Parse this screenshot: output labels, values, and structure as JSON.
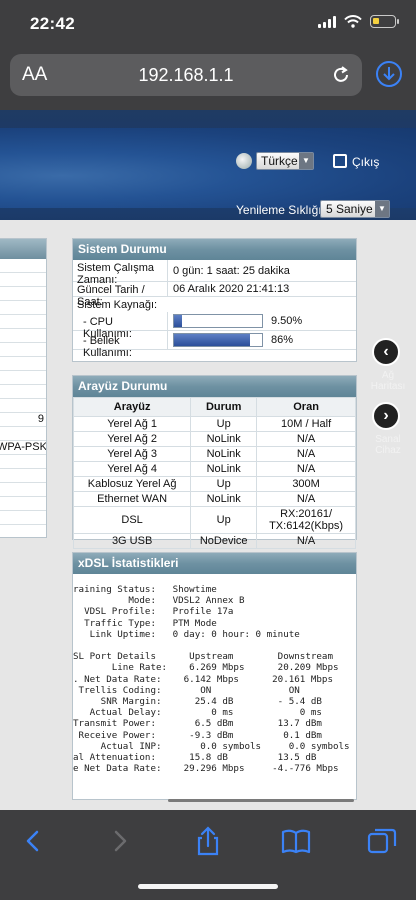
{
  "status_bar": {
    "time": "22:42"
  },
  "browser": {
    "text_size_label": "AA",
    "url": "192.168.1.1"
  },
  "header": {
    "language": "Türkçe",
    "logout": "Çıkış",
    "refresh_label": "Yenileme Sıklığı:",
    "refresh_value": "5 Saniye"
  },
  "left_panel": {
    "rows": [
      "",
      "",
      "",
      "",
      "",
      "",
      "",
      "",
      "",
      "",
      "",
      "9",
      "",
      "WPA-PSK",
      "",
      "",
      "",
      "",
      ""
    ]
  },
  "system_status": {
    "title": "Sistem Durumu",
    "uptime_label": "Sistem Çalışma Zamanı:",
    "uptime_value": "0 gün: 1 saat: 25 dakika",
    "datetime_label": "Güncel Tarih / Saat:",
    "datetime_value": "06 Aralık 2020 21:41:13",
    "resources_label": "Sistem Kaynağı:",
    "cpu_label": "- CPU Kullanımı:",
    "cpu_value": "9.50%",
    "cpu_fraction": 0.095,
    "mem_label": "- Bellek Kullanımı:",
    "mem_value": "86%",
    "mem_fraction": 0.86
  },
  "interface_status": {
    "title": "Arayüz Durumu",
    "columns": [
      "Arayüz",
      "Durum",
      "Oran"
    ],
    "rows": [
      [
        "Yerel Ağ 1",
        "Up",
        "10M / Half"
      ],
      [
        "Yerel Ağ 2",
        "NoLink",
        "N/A"
      ],
      [
        "Yerel Ağ 3",
        "NoLink",
        "N/A"
      ],
      [
        "Yerel Ağ 4",
        "NoLink",
        "N/A"
      ],
      [
        "Kablosuz Yerel Ağ",
        "Up",
        "300M"
      ],
      [
        "Ethernet WAN",
        "NoLink",
        "N/A"
      ],
      [
        "DSL",
        "Up",
        "RX:20161/\nTX:6142(Kbps)"
      ],
      [
        "3G USB",
        "NoDevice",
        "N/A"
      ]
    ]
  },
  "xdsl": {
    "title": "xDSL İstatistikleri",
    "lines": [
      "raining Status:   Showtime",
      "          Mode:   VDSL2 Annex B",
      "  VDSL Profile:   Profile 17a",
      "  Traffic Type:   PTM Mode",
      "   Link Uptime:   0 day: 0 hour: 0 minute",
      "",
      "SL Port Details      Upstream        Downstream",
      "       Line Rate:    6.269 Mbps      20.209 Mbps",
      ". Net Data Rate:    6.142 Mbps      20.161 Mbps",
      " Trellis Coding:       ON              ON",
      "     SNR Margin:      25.4 dB        - 5.4 dB",
      "   Actual Delay:         0 ms            0 ms",
      "Transmit Power:       6.5 dBm        13.7 dBm",
      " Receive Power:      -9.3 dBm         0.1 dBm",
      "     Actual INP:       0.0 symbols     0.0 symbols",
      "al Attenuation:      15.8 dB         13.5 dB",
      "e Net Data Rate:    29.296 Mbps     -4.-776 Mbps"
    ]
  },
  "side_nav": {
    "map_label": "Ağ Haritası",
    "virtual_label": "Sanal Cihaz"
  }
}
